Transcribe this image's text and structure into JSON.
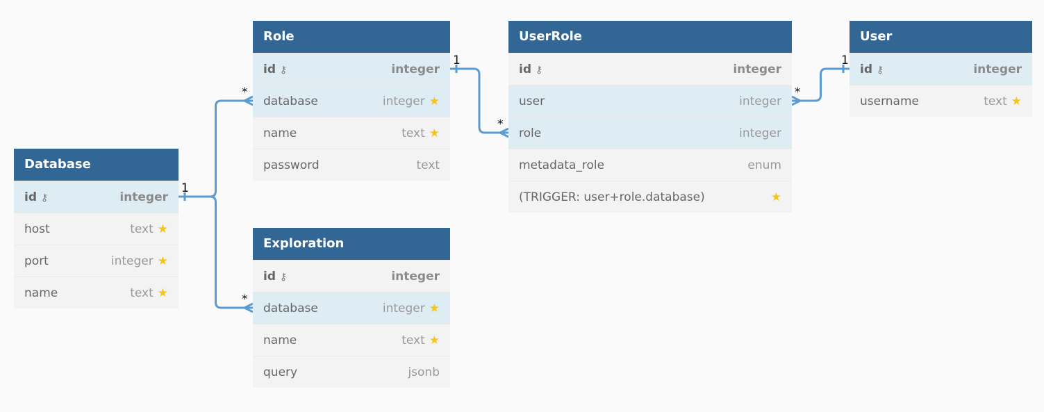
{
  "colors": {
    "header": "#326795",
    "highlight_row": "#deecf4",
    "row": "#f3f3f3",
    "edge": "#5b9bd0",
    "star": "#f5c518"
  },
  "tables": [
    {
      "id": "Role",
      "title": "Role",
      "columns": [
        {
          "name": "id",
          "type": "integer",
          "pk": true,
          "hl": true,
          "icon": "key-icon"
        },
        {
          "name": "database",
          "type": "integer",
          "hl": true,
          "star": true
        },
        {
          "name": "name",
          "type": "text",
          "star": true
        },
        {
          "name": "password",
          "type": "text"
        }
      ]
    },
    {
      "id": "UserRole",
      "title": "UserRole",
      "columns": [
        {
          "name": "id",
          "type": "integer",
          "pk": true,
          "icon": "key-icon"
        },
        {
          "name": "user",
          "type": "integer",
          "hl": true
        },
        {
          "name": "role",
          "type": "integer",
          "hl": true
        },
        {
          "name": "metadata_role",
          "type": "enum"
        },
        {
          "name": "(TRIGGER: user+role.database)",
          "type": "",
          "star": true
        }
      ]
    },
    {
      "id": "User",
      "title": "User",
      "columns": [
        {
          "name": "id",
          "type": "integer",
          "pk": true,
          "hl": true,
          "icon": "key-icon"
        },
        {
          "name": "username",
          "type": "text",
          "star": true
        }
      ]
    },
    {
      "id": "Database",
      "title": "Database",
      "columns": [
        {
          "name": "id",
          "type": "integer",
          "pk": true,
          "hl": true,
          "icon": "key-icon"
        },
        {
          "name": "host",
          "type": "text",
          "star": true
        },
        {
          "name": "port",
          "type": "integer",
          "star": true
        },
        {
          "name": "name",
          "type": "text",
          "star": true
        }
      ]
    },
    {
      "id": "Exploration",
      "title": "Exploration",
      "columns": [
        {
          "name": "id",
          "type": "integer",
          "pk": true,
          "icon": "key-icon"
        },
        {
          "name": "database",
          "type": "integer",
          "hl": true,
          "star": true
        },
        {
          "name": "name",
          "type": "text",
          "star": true
        },
        {
          "name": "query",
          "type": "jsonb"
        }
      ]
    }
  ],
  "relations": [
    {
      "from": "Database.id",
      "to": "Role.database",
      "from_card": "1",
      "to_card": "*"
    },
    {
      "from": "Database.id",
      "to": "Exploration.database",
      "from_card": "1",
      "to_card": "*"
    },
    {
      "from": "Role.id",
      "to": "UserRole.role",
      "from_card": "1",
      "to_card": "*"
    },
    {
      "from": "User.id",
      "to": "UserRole.user",
      "from_card": "1",
      "to_card": "*"
    }
  ]
}
